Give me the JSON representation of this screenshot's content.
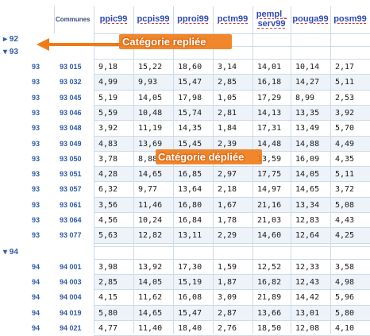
{
  "header": {
    "communes_label": "Communes",
    "columns": [
      "ppic99",
      "pcpis99",
      "pproi99",
      "pctm99",
      "pempl_\nserv99",
      "pouga99",
      "posm99"
    ]
  },
  "groups": [
    {
      "code": "92",
      "collapsed": true,
      "rows": []
    },
    {
      "code": "93",
      "collapsed": false,
      "rows": [
        {
          "dept": "93",
          "commune": "93 015",
          "values": [
            "9,18",
            "15,22",
            "18,60",
            "3,14",
            "14,01",
            "10,14",
            "2,17"
          ]
        },
        {
          "dept": "93",
          "commune": "93 032",
          "values": [
            "4,99",
            "9,93",
            "15,47",
            "2,85",
            "16,18",
            "14,27",
            "5,11"
          ]
        },
        {
          "dept": "93",
          "commune": "93 045",
          "values": [
            "5,19",
            "14,05",
            "17,98",
            "1,05",
            "17,29",
            "8,99",
            "2,53"
          ]
        },
        {
          "dept": "93",
          "commune": "93 046",
          "values": [
            "5,59",
            "10,48",
            "15,74",
            "2,81",
            "14,13",
            "13,35",
            "3,92"
          ]
        },
        {
          "dept": "93",
          "commune": "93 048",
          "values": [
            "3,92",
            "11,19",
            "14,35",
            "1,84",
            "17,31",
            "13,49",
            "5,70"
          ]
        },
        {
          "dept": "93",
          "commune": "93 049",
          "values": [
            "4,83",
            "13,69",
            "15,45",
            "2,39",
            "14,48",
            "14,88",
            "4,49"
          ]
        },
        {
          "dept": "93",
          "commune": "93 050",
          "values": [
            "3,78",
            "8,88",
            "",
            "",
            "13,59",
            "16,09",
            "4,35"
          ]
        },
        {
          "dept": "93",
          "commune": "93 051",
          "values": [
            "4,28",
            "14,65",
            "16,85",
            "2,97",
            "17,75",
            "14,05",
            "5,11"
          ]
        },
        {
          "dept": "93",
          "commune": "93 057",
          "values": [
            "6,32",
            "9,77",
            "13,64",
            "2,18",
            "14,97",
            "14,65",
            "3,72"
          ]
        },
        {
          "dept": "93",
          "commune": "93 061",
          "values": [
            "3,56",
            "11,46",
            "16,80",
            "1,67",
            "21,16",
            "13,34",
            "5,08"
          ]
        },
        {
          "dept": "93",
          "commune": "93 064",
          "values": [
            "4,56",
            "10,24",
            "16,84",
            "1,78",
            "21,03",
            "12,83",
            "4,43"
          ]
        },
        {
          "dept": "93",
          "commune": "93 077",
          "values": [
            "5,63",
            "12,82",
            "13,11",
            "2,29",
            "14,60",
            "12,64",
            "4,25"
          ]
        }
      ]
    },
    {
      "code": "94",
      "collapsed": false,
      "rows": [
        {
          "dept": "94",
          "commune": "94 001",
          "values": [
            "3,98",
            "13,92",
            "17,30",
            "1,59",
            "12,52",
            "12,33",
            "3,58"
          ]
        },
        {
          "dept": "94",
          "commune": "94 003",
          "values": [
            "2,85",
            "14,05",
            "15,19",
            "1,87",
            "16,82",
            "12,43",
            "4,98"
          ]
        },
        {
          "dept": "94",
          "commune": "94 004",
          "values": [
            "4,15",
            "11,62",
            "16,08",
            "3,09",
            "21,89",
            "14,42",
            "5,96"
          ]
        },
        {
          "dept": "94",
          "commune": "94 019",
          "values": [
            "5,80",
            "14,65",
            "15,47",
            "2,87",
            "13,66",
            "13,01",
            "5,80"
          ]
        },
        {
          "dept": "94",
          "commune": "94 021",
          "values": [
            "4,77",
            "11,40",
            "18,40",
            "2,76",
            "18,50",
            "12,08",
            "4,10"
          ]
        }
      ]
    }
  ],
  "annotations": {
    "collapsed": "Catégorie repliée",
    "expanded": "Catégorie dépliée"
  },
  "colors": {
    "accent": "#f07a16",
    "header_text": "#2f4bb3",
    "grid": "#cfdbe8"
  }
}
